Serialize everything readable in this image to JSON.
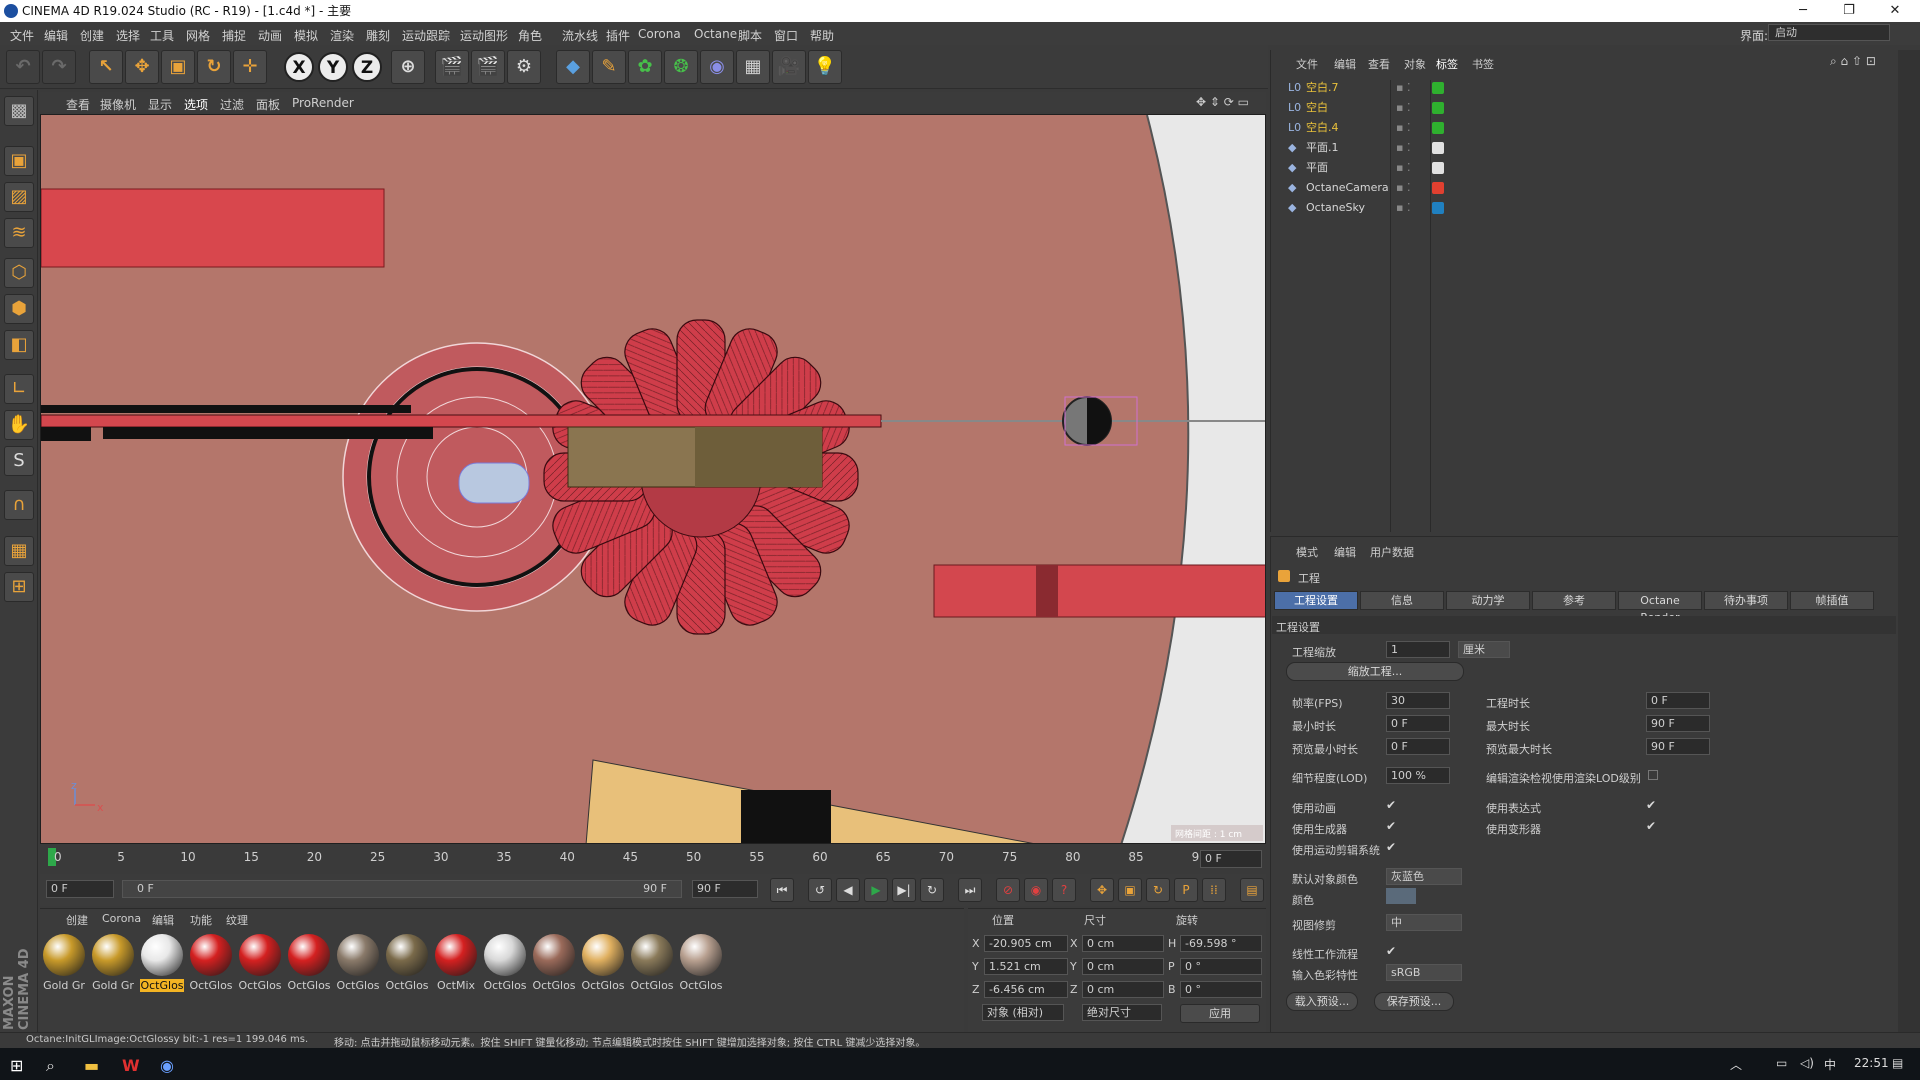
{
  "window": {
    "title": "CINEMA 4D R19.024 Studio (RC - R19) - [1.c4d *] - 主要",
    "minimize": "─",
    "maximize": "❐",
    "close": "✕"
  },
  "menubar": {
    "items": [
      "文件",
      "编辑",
      "创建",
      "选择",
      "工具",
      "网格",
      "捕捉",
      "动画",
      "模拟",
      "渲染",
      "雕刻",
      "运动跟踪",
      "运动图形",
      "角色",
      "流水线",
      "插件",
      "Corona",
      "Octane",
      "脚本",
      "窗口",
      "帮助"
    ],
    "layout_label": "界面:",
    "layout_value": "启动"
  },
  "toolbar": {
    "axis_x": "X",
    "axis_y": "Y",
    "axis_z": "Z"
  },
  "viewport": {
    "menu": [
      "查看",
      "摄像机",
      "显示",
      "选项",
      "过滤",
      "面板",
      "ProRender"
    ],
    "axis_z": "z",
    "axis_x": "x",
    "grid_info": "网格间距 : 1 cm"
  },
  "timeline": {
    "ticks": [
      "0",
      "5",
      "10",
      "15",
      "20",
      "25",
      "30",
      "35",
      "40",
      "45",
      "50",
      "55",
      "60",
      "65",
      "70",
      "75",
      "80",
      "85",
      "90"
    ],
    "current_frame": "0 F"
  },
  "playbar": {
    "start_field": "0 F",
    "range_start": "0 F",
    "range_end": "90 F",
    "end_field": "90 F"
  },
  "materials": {
    "tabs": [
      "创建",
      "Corona",
      "编辑",
      "功能",
      "纹理"
    ],
    "items": [
      {
        "label": "Gold Gr",
        "color": "#c89a2a"
      },
      {
        "label": "Gold Gr",
        "color": "#c89a2a"
      },
      {
        "label": "OctGlos",
        "color": "#e8e8e8"
      },
      {
        "label": "OctGlos",
        "color": "#d42020"
      },
      {
        "label": "OctGlos",
        "color": "#d42020"
      },
      {
        "label": "OctGlos",
        "color": "#d42020"
      },
      {
        "label": "OctGlos",
        "color": "#8a7a6a"
      },
      {
        "label": "OctGlos",
        "color": "#7a6a4a"
      },
      {
        "label": "OctMix",
        "color": "#d42020"
      },
      {
        "label": "OctGlos",
        "color": "#d8d8d8"
      },
      {
        "label": "OctGlos",
        "color": "#9a6a5a"
      },
      {
        "label": "OctGlos",
        "color": "#e0b060"
      },
      {
        "label": "OctGlos",
        "color": "#8a7a5a"
      },
      {
        "label": "OctGlos",
        "color": "#b8a090"
      }
    ],
    "selected_index": 2
  },
  "coords": {
    "headers": [
      "位置",
      "尺寸",
      "旋转"
    ],
    "rows": [
      {
        "axis": "X",
        "pos": "-20.905 cm",
        "size_axis": "X",
        "size": "0 cm",
        "rot_axis": "H",
        "rot": "-69.598 °"
      },
      {
        "axis": "Y",
        "pos": "1.521 cm",
        "size_axis": "Y",
        "size": "0 cm",
        "rot_axis": "P",
        "rot": "0 °"
      },
      {
        "axis": "Z",
        "pos": "-6.456 cm",
        "size_axis": "Z",
        "size": "0 cm",
        "rot_axis": "B",
        "rot": "0 °"
      }
    ],
    "mode1": "对象 (相对)",
    "mode2": "绝对尺寸",
    "apply": "应用"
  },
  "object_manager": {
    "tabs": [
      "文件",
      "编辑",
      "查看",
      "对象",
      "标签",
      "书签"
    ],
    "objects": [
      {
        "name": "空白.7",
        "highlight": true
      },
      {
        "name": "空白",
        "highlight": true
      },
      {
        "name": "空白.4",
        "highlight": true
      },
      {
        "name": "平面.1",
        "highlight": false
      },
      {
        "name": "平面",
        "highlight": false
      },
      {
        "name": "OctaneCamera",
        "highlight": false
      },
      {
        "name": "OctaneSky",
        "highlight": false
      }
    ]
  },
  "attribute_manager": {
    "tabs": [
      "模式",
      "编辑",
      "用户数据"
    ],
    "title": "工程",
    "subtabs": [
      "工程设置",
      "信息",
      "动力学",
      "参考",
      "Octane Render",
      "待办事项",
      "帧插值"
    ],
    "section": "工程设置",
    "scale_label": "工程缩放",
    "scale_value": "1",
    "scale_unit": "厘米",
    "scale_button": "缩放工程...",
    "fps_label": "帧率(FPS)",
    "fps_value": "30",
    "duration_label": "工程时长",
    "duration_value": "0 F",
    "min_label": "最小时长",
    "min_value": "0 F",
    "max_label": "最大时长",
    "max_value": "90 F",
    "pmin_label": "预览最小时长",
    "pmin_value": "0 F",
    "pmax_label": "预览最大时长",
    "pmax_value": "90 F",
    "lod_label": "细节程度(LOD)",
    "lod_value": "100 %",
    "lod_check_label": "编辑渲染检视使用渲染LOD级别",
    "anim_label": "使用动画",
    "expr_label": "使用表达式",
    "gen_label": "使用生成器",
    "deform_label": "使用变形器",
    "motion_label": "使用运动剪辑系统",
    "defcolor_label": "默认对象颜色",
    "defcolor_value": "灰蓝色",
    "color_label": "颜色",
    "clip_label": "视图修剪",
    "clip_value": "中",
    "linear_label": "线性工作流程",
    "colorprofile_label": "输入色彩特性",
    "colorprofile_value": "sRGB",
    "load_preset": "载入预设...",
    "save_preset": "保存预设..."
  },
  "status": {
    "left": "Octane:InitGLImage:OctGlossy  bit:-1 res=1  199.046 ms.",
    "right": "移动: 点击并拖动鼠标移动元素。按住 SHIFT 键量化移动; 节点编辑模式时按住 SHIFT 键增加选择对象; 按住 CTRL 键减少选择对象。"
  },
  "taskbar": {
    "time": "22:51"
  }
}
